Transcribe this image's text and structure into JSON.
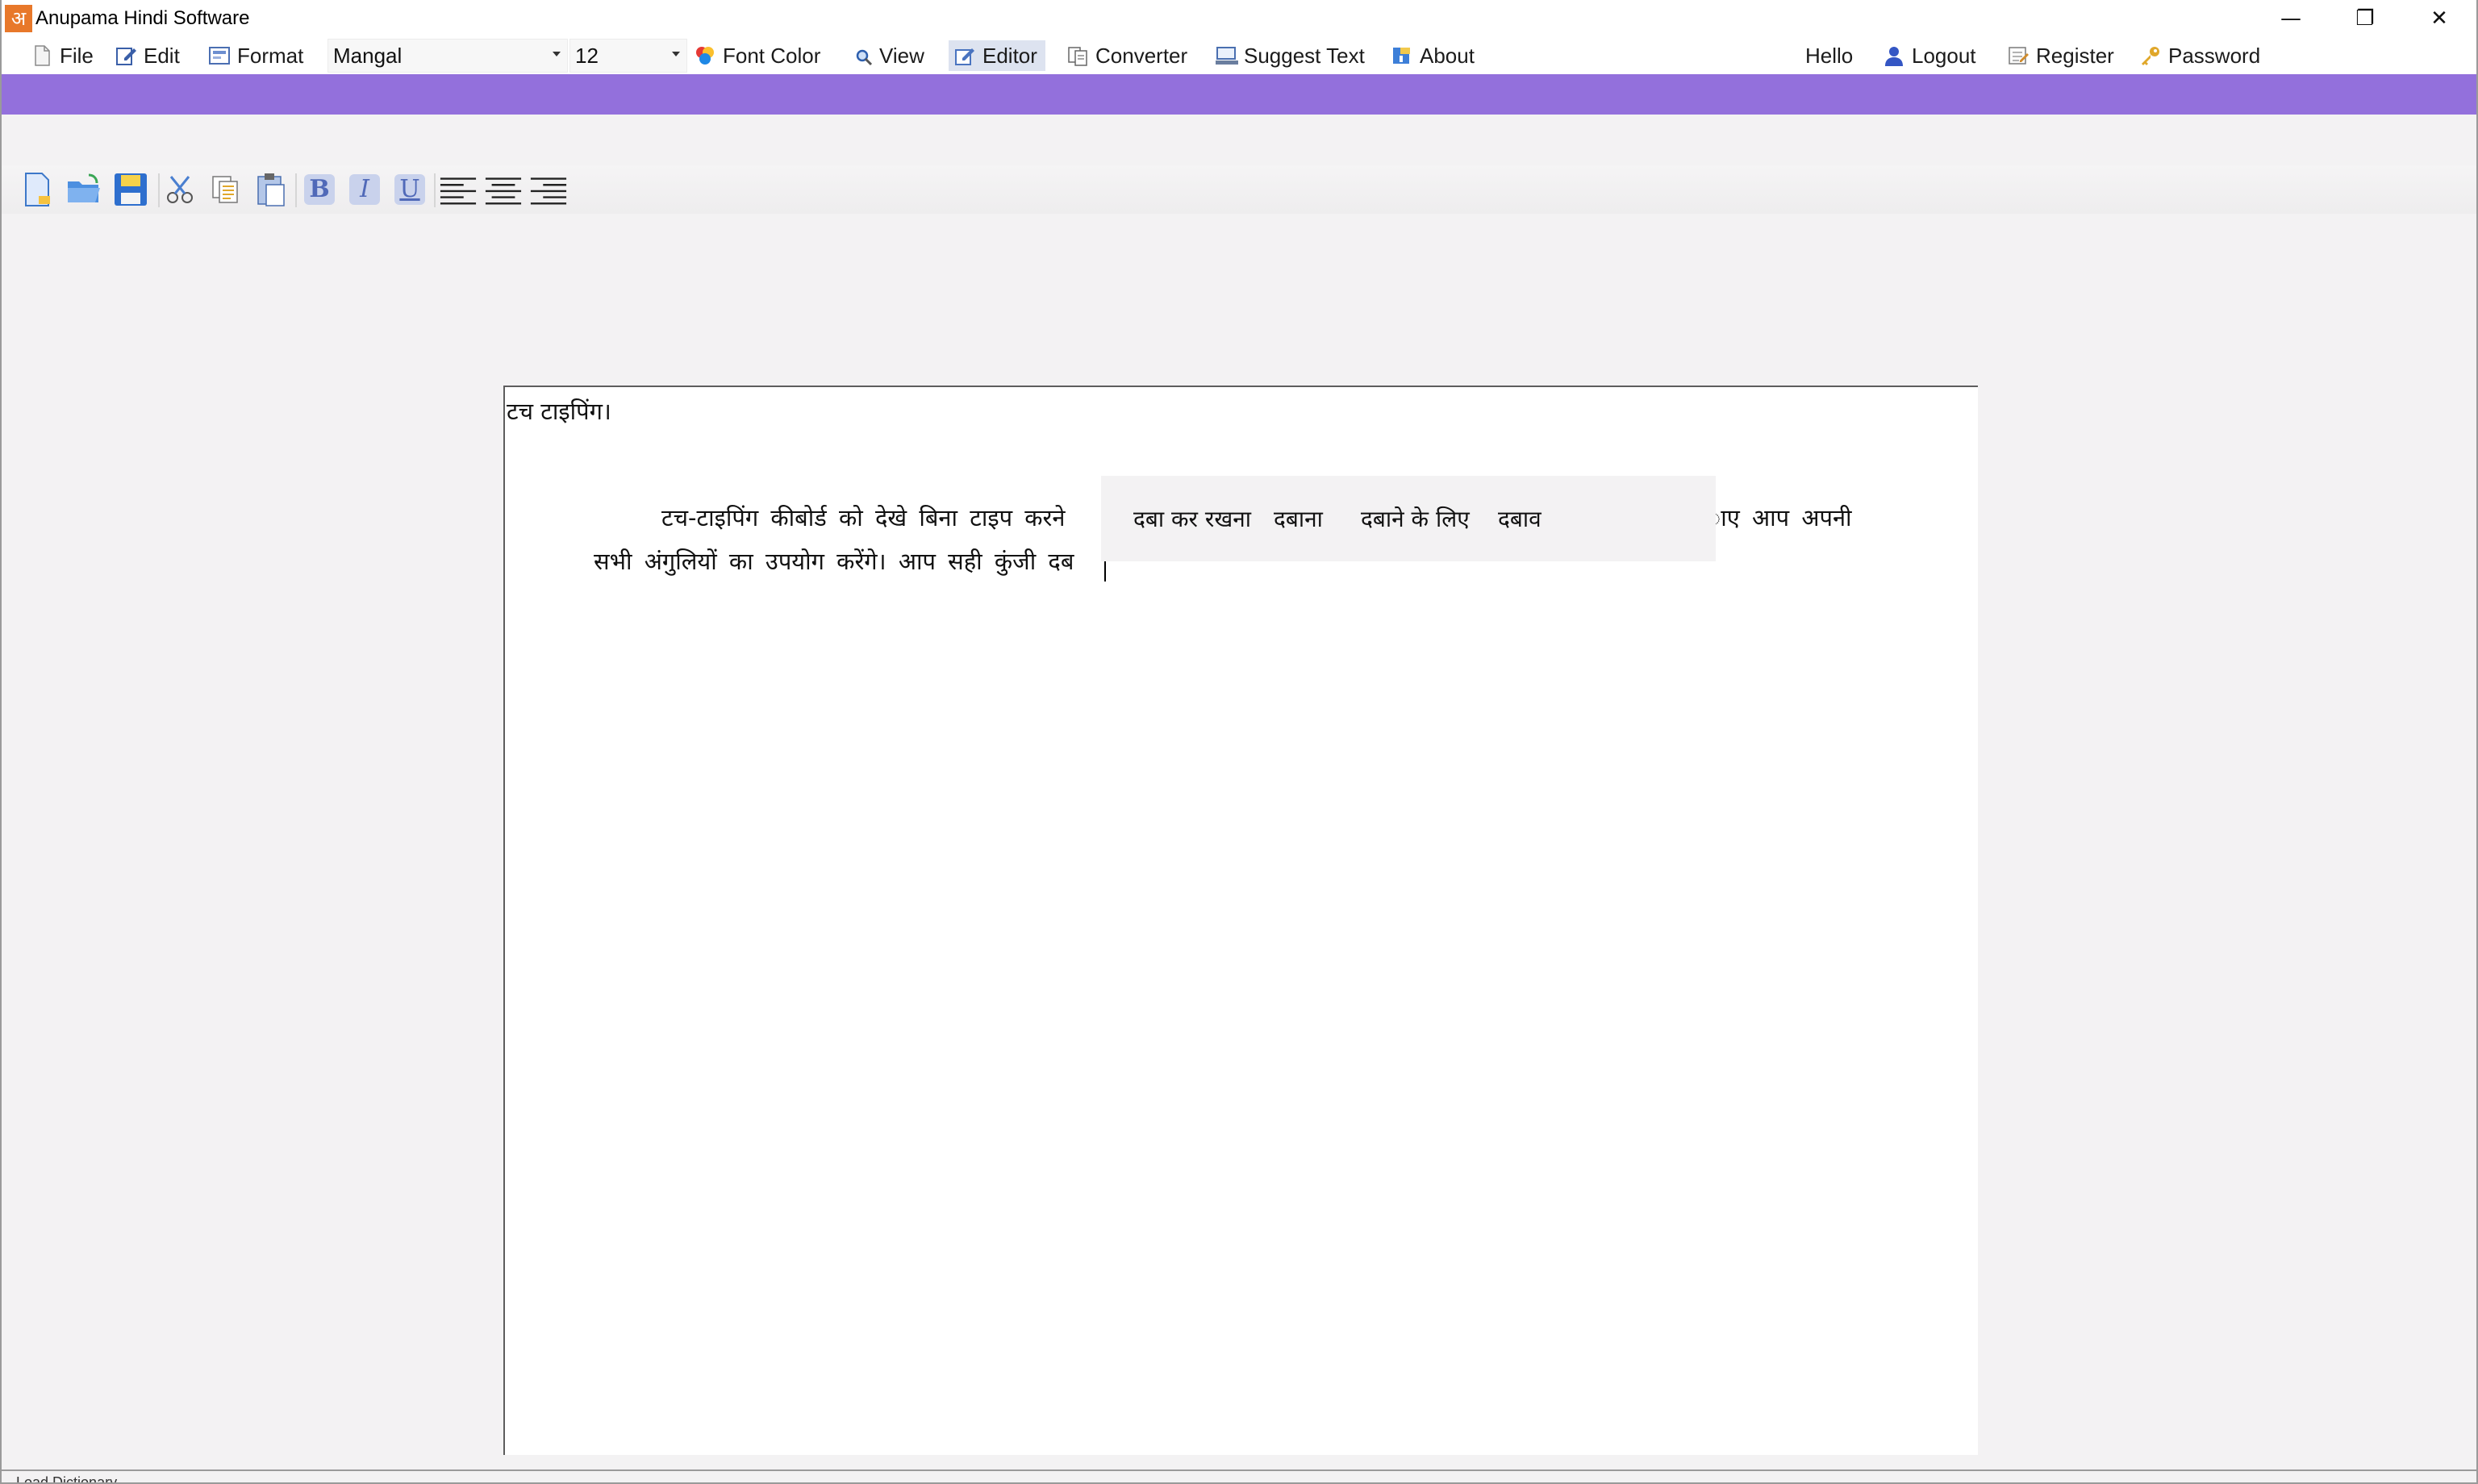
{
  "window": {
    "app_logo": "अ",
    "title": "Anupama Hindi Software",
    "minimize": "—",
    "maximize": "❐",
    "close": "✕"
  },
  "menu": {
    "file": "File",
    "edit": "Edit",
    "format": "Format",
    "font_name": "Mangal",
    "font_size": "12",
    "font_color": "Font Color",
    "view": "View",
    "editor": "Editor",
    "converter": "Converter",
    "suggest_text": "Suggest Text",
    "about": "About",
    "hello": "Hello",
    "logout": "Logout",
    "register": "Register",
    "password": "Password"
  },
  "toolbar": {
    "bold": "B",
    "italic": "I",
    "underline": "U"
  },
  "editor": {
    "heading": "टच टाइपिंग।",
    "line1_start": "टच-टाइपिंग कीबोर्ड को देखे बिना टाइप करने",
    "line1_end": "ाए आप अपनी",
    "line2": "सभी अंगुलियों का उपयोग करेंगे। आप सही कुंजी दब"
  },
  "suggestions": [
    "दबा कर रखना",
    "दबाना",
    "दबाने के लिए",
    "दबाव"
  ],
  "status": {
    "text": "Load Dictionary ..."
  },
  "colors": {
    "accent_band": "#9370dc",
    "logo": "#e8782a"
  }
}
